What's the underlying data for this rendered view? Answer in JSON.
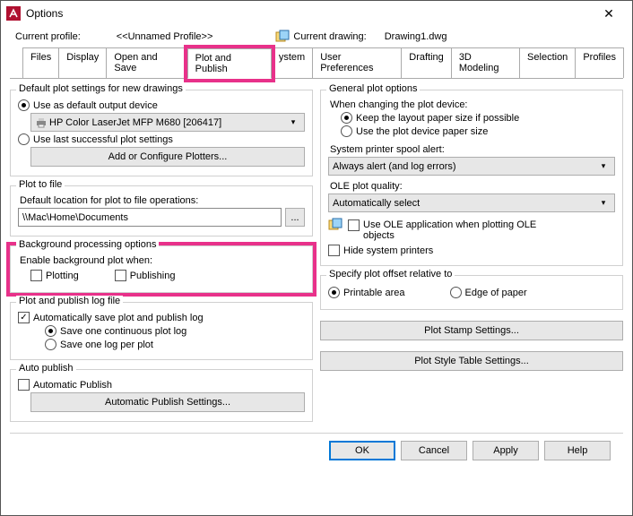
{
  "window": {
    "title": "Options"
  },
  "profile": {
    "label": "Current profile:",
    "value": "<<Unnamed Profile>>",
    "drawing_label": "Current drawing:",
    "drawing_value": "Drawing1.dwg"
  },
  "tabs": {
    "files": "Files",
    "display": "Display",
    "open_save": "Open and Save",
    "plot_publish": "Plot and Publish",
    "system_partial": "ystem",
    "user_pref": "User Preferences",
    "drafting": "Drafting",
    "modeling": "3D Modeling",
    "selection": "Selection",
    "profiles": "Profiles"
  },
  "left": {
    "group1_title": "Default plot settings for new drawings",
    "radio_default_output": "Use as default output device",
    "printer_value": "HP Color LaserJet MFP M680 [206417]",
    "radio_last_plot": "Use last successful plot settings",
    "btn_configure": "Add or Configure Plotters...",
    "group2_title": "Plot to file",
    "plot_file_label": "Default location for plot to file operations:",
    "plot_file_value": "\\\\Mac\\Home\\Documents",
    "browse_dots": "...",
    "group3_title": "Background processing options",
    "bg_enable_label": "Enable background plot when:",
    "chk_plotting": "Plotting",
    "chk_publishing": "Publishing",
    "group4_title": "Plot and publish log file",
    "chk_auto_save": "Automatically save plot and publish log",
    "radio_continuous": "Save one continuous plot log",
    "radio_per_plot": "Save one log per plot",
    "group5_title": "Auto publish",
    "chk_auto_publish": "Automatic Publish",
    "btn_auto_settings": "Automatic Publish Settings..."
  },
  "right": {
    "group1_title": "General plot options",
    "change_device_label": "When changing the plot device:",
    "radio_keep_layout": "Keep the layout paper size if possible",
    "radio_use_device": "Use the plot device paper size",
    "spool_label": "System printer spool alert:",
    "spool_value": "Always alert (and log errors)",
    "ole_label": "OLE plot quality:",
    "ole_value": "Automatically select",
    "chk_ole_app": "Use OLE application when plotting OLE objects",
    "chk_hide_printers": "Hide system printers",
    "group2_title": "Specify plot offset relative to",
    "radio_printable": "Printable area",
    "radio_edge": "Edge of paper",
    "btn_plot_stamp": "Plot Stamp Settings...",
    "btn_plot_style": "Plot Style Table Settings..."
  },
  "buttons": {
    "ok": "OK",
    "cancel": "Cancel",
    "apply": "Apply",
    "help": "Help"
  }
}
